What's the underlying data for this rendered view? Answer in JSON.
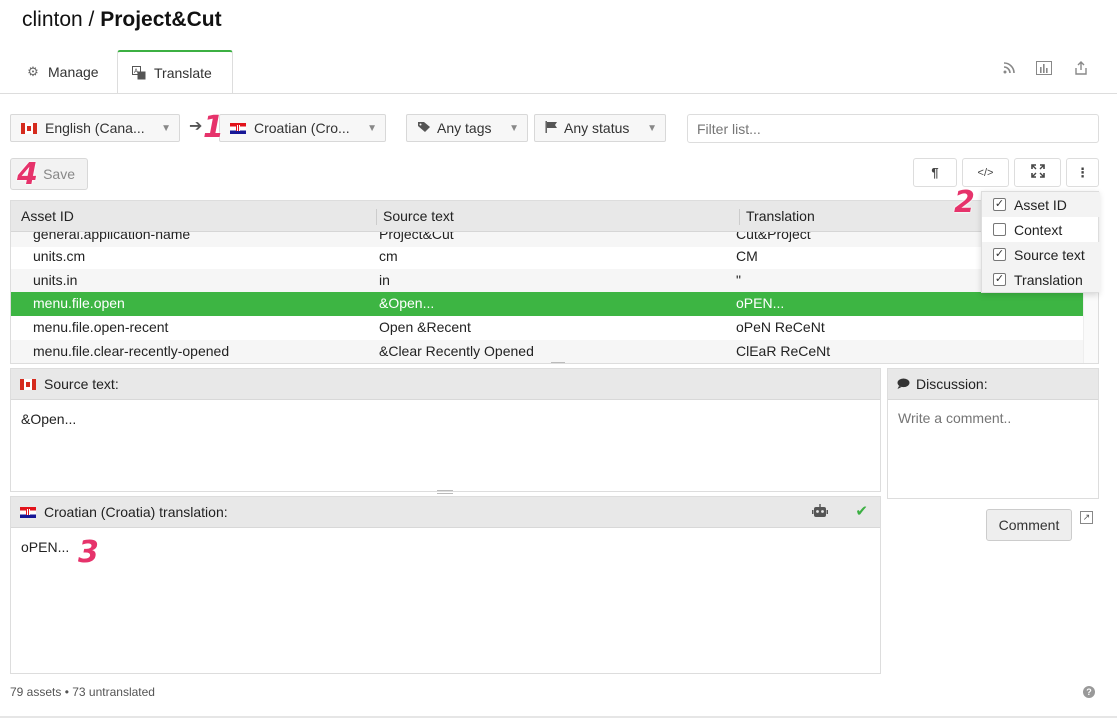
{
  "header": {
    "owner": "clinton",
    "separator": " / ",
    "project": "Project&Cut"
  },
  "tabs": [
    {
      "label": "Manage",
      "icon": "gears-icon",
      "active": false
    },
    {
      "label": "Translate",
      "icon": "translate-icon",
      "active": true
    }
  ],
  "header_icons": [
    "rss-icon",
    "stats-icon",
    "export-icon"
  ],
  "toolbar": {
    "source_lang": "English (Cana...",
    "target_lang": "Croatian (Cro...",
    "tags": "Any tags",
    "status": "Any status",
    "filter_placeholder": "Filter list...",
    "save_label": "Save"
  },
  "badges": {
    "one": "1",
    "two": "2",
    "three": "3",
    "four": "4"
  },
  "view_buttons": {
    "pilcrow": "¶",
    "code": "</>",
    "expand": "⛶",
    "more": "⋮"
  },
  "table": {
    "headers": [
      "Asset ID",
      "Source text",
      "Translation"
    ],
    "rows": [
      {
        "id": "general.application-name",
        "source": "Project&Cut",
        "translation": "Cut&Project"
      },
      {
        "id": "units.cm",
        "source": "cm",
        "translation": "CM"
      },
      {
        "id": "units.in",
        "source": "in",
        "translation": "\""
      },
      {
        "id": "menu.file.open",
        "source": "&Open...",
        "translation": "oPEN...",
        "selected": true
      },
      {
        "id": "menu.file.open-recent",
        "source": "Open &Recent",
        "translation": "oPeN ReCeNt"
      },
      {
        "id": "menu.file.clear-recently-opened",
        "source": "&Clear Recently Opened",
        "translation": "ClEaR ReCeNt"
      }
    ]
  },
  "column_menu": [
    {
      "label": "Asset ID",
      "checked": true
    },
    {
      "label": "Context",
      "checked": false
    },
    {
      "label": "Source text",
      "checked": true
    },
    {
      "label": "Translation",
      "checked": true
    }
  ],
  "source_panel": {
    "title": "Source text:",
    "text": "&Open..."
  },
  "translation_panel": {
    "title": "Croatian (Croatia) translation:",
    "text": "oPEN..."
  },
  "discussion": {
    "title": "Discussion:",
    "placeholder": "Write a comment..",
    "button": "Comment"
  },
  "footer": {
    "status": "79 assets • 73 untranslated"
  },
  "colors": {
    "accent": "#3db543",
    "badge": "#e6336b"
  }
}
